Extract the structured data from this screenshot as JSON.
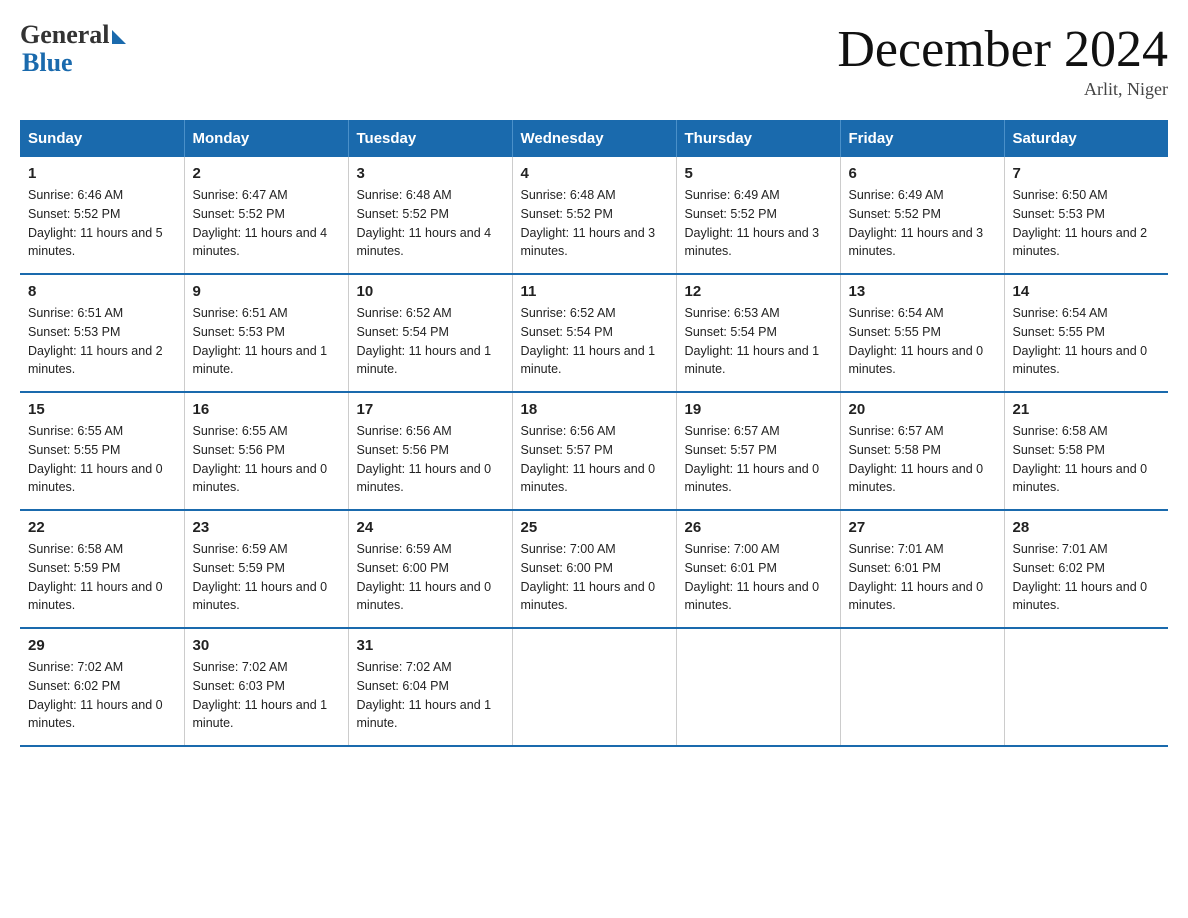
{
  "logo": {
    "general": "General",
    "blue": "Blue",
    "tagline": "Blue"
  },
  "title": "December 2024",
  "subtitle": "Arlit, Niger",
  "days_of_week": [
    "Sunday",
    "Monday",
    "Tuesday",
    "Wednesday",
    "Thursday",
    "Friday",
    "Saturday"
  ],
  "weeks": [
    [
      {
        "day": "1",
        "sunrise": "6:46 AM",
        "sunset": "5:52 PM",
        "daylight": "11 hours and 5 minutes."
      },
      {
        "day": "2",
        "sunrise": "6:47 AM",
        "sunset": "5:52 PM",
        "daylight": "11 hours and 4 minutes."
      },
      {
        "day": "3",
        "sunrise": "6:48 AM",
        "sunset": "5:52 PM",
        "daylight": "11 hours and 4 minutes."
      },
      {
        "day": "4",
        "sunrise": "6:48 AM",
        "sunset": "5:52 PM",
        "daylight": "11 hours and 3 minutes."
      },
      {
        "day": "5",
        "sunrise": "6:49 AM",
        "sunset": "5:52 PM",
        "daylight": "11 hours and 3 minutes."
      },
      {
        "day": "6",
        "sunrise": "6:49 AM",
        "sunset": "5:52 PM",
        "daylight": "11 hours and 3 minutes."
      },
      {
        "day": "7",
        "sunrise": "6:50 AM",
        "sunset": "5:53 PM",
        "daylight": "11 hours and 2 minutes."
      }
    ],
    [
      {
        "day": "8",
        "sunrise": "6:51 AM",
        "sunset": "5:53 PM",
        "daylight": "11 hours and 2 minutes."
      },
      {
        "day": "9",
        "sunrise": "6:51 AM",
        "sunset": "5:53 PM",
        "daylight": "11 hours and 1 minute."
      },
      {
        "day": "10",
        "sunrise": "6:52 AM",
        "sunset": "5:54 PM",
        "daylight": "11 hours and 1 minute."
      },
      {
        "day": "11",
        "sunrise": "6:52 AM",
        "sunset": "5:54 PM",
        "daylight": "11 hours and 1 minute."
      },
      {
        "day": "12",
        "sunrise": "6:53 AM",
        "sunset": "5:54 PM",
        "daylight": "11 hours and 1 minute."
      },
      {
        "day": "13",
        "sunrise": "6:54 AM",
        "sunset": "5:55 PM",
        "daylight": "11 hours and 0 minutes."
      },
      {
        "day": "14",
        "sunrise": "6:54 AM",
        "sunset": "5:55 PM",
        "daylight": "11 hours and 0 minutes."
      }
    ],
    [
      {
        "day": "15",
        "sunrise": "6:55 AM",
        "sunset": "5:55 PM",
        "daylight": "11 hours and 0 minutes."
      },
      {
        "day": "16",
        "sunrise": "6:55 AM",
        "sunset": "5:56 PM",
        "daylight": "11 hours and 0 minutes."
      },
      {
        "day": "17",
        "sunrise": "6:56 AM",
        "sunset": "5:56 PM",
        "daylight": "11 hours and 0 minutes."
      },
      {
        "day": "18",
        "sunrise": "6:56 AM",
        "sunset": "5:57 PM",
        "daylight": "11 hours and 0 minutes."
      },
      {
        "day": "19",
        "sunrise": "6:57 AM",
        "sunset": "5:57 PM",
        "daylight": "11 hours and 0 minutes."
      },
      {
        "day": "20",
        "sunrise": "6:57 AM",
        "sunset": "5:58 PM",
        "daylight": "11 hours and 0 minutes."
      },
      {
        "day": "21",
        "sunrise": "6:58 AM",
        "sunset": "5:58 PM",
        "daylight": "11 hours and 0 minutes."
      }
    ],
    [
      {
        "day": "22",
        "sunrise": "6:58 AM",
        "sunset": "5:59 PM",
        "daylight": "11 hours and 0 minutes."
      },
      {
        "day": "23",
        "sunrise": "6:59 AM",
        "sunset": "5:59 PM",
        "daylight": "11 hours and 0 minutes."
      },
      {
        "day": "24",
        "sunrise": "6:59 AM",
        "sunset": "6:00 PM",
        "daylight": "11 hours and 0 minutes."
      },
      {
        "day": "25",
        "sunrise": "7:00 AM",
        "sunset": "6:00 PM",
        "daylight": "11 hours and 0 minutes."
      },
      {
        "day": "26",
        "sunrise": "7:00 AM",
        "sunset": "6:01 PM",
        "daylight": "11 hours and 0 minutes."
      },
      {
        "day": "27",
        "sunrise": "7:01 AM",
        "sunset": "6:01 PM",
        "daylight": "11 hours and 0 minutes."
      },
      {
        "day": "28",
        "sunrise": "7:01 AM",
        "sunset": "6:02 PM",
        "daylight": "11 hours and 0 minutes."
      }
    ],
    [
      {
        "day": "29",
        "sunrise": "7:02 AM",
        "sunset": "6:02 PM",
        "daylight": "11 hours and 0 minutes."
      },
      {
        "day": "30",
        "sunrise": "7:02 AM",
        "sunset": "6:03 PM",
        "daylight": "11 hours and 1 minute."
      },
      {
        "day": "31",
        "sunrise": "7:02 AM",
        "sunset": "6:04 PM",
        "daylight": "11 hours and 1 minute."
      },
      null,
      null,
      null,
      null
    ]
  ]
}
